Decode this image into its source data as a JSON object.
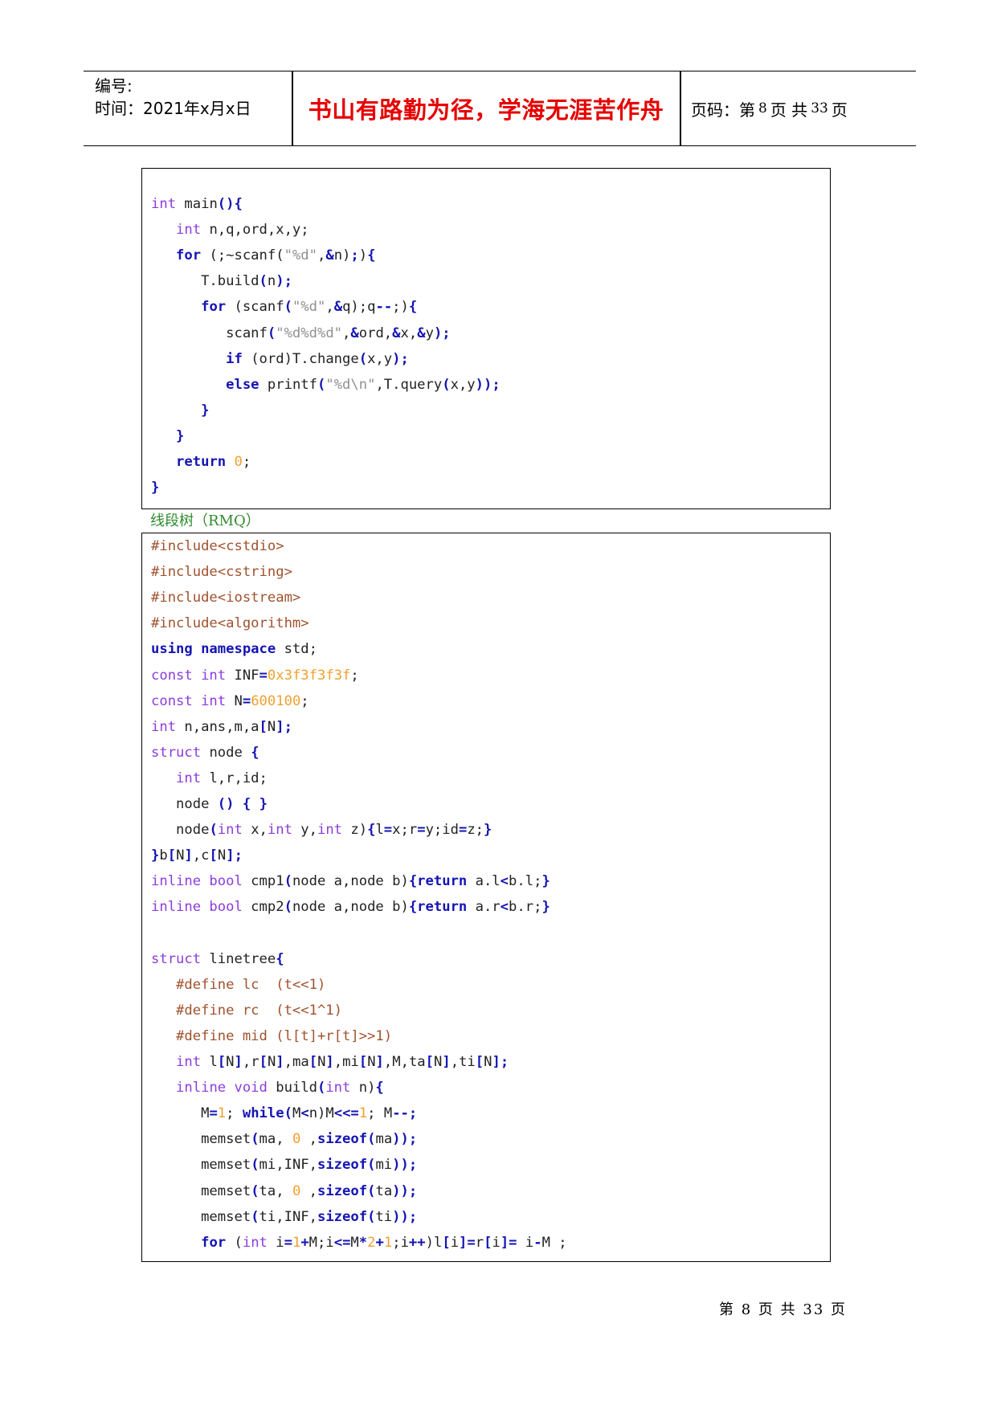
{
  "header": {
    "doc_number_label": "编号:",
    "time_label": "时间：2021年x月x日",
    "motto": "书山有路勤为径，学海无涯苦作舟",
    "page_label_prefix": "页码：第",
    "page_current": "8",
    "page_mid": "页  共",
    "page_total": "33",
    "page_suffix": "页"
  },
  "code_block_1": [
    [
      {
        "cls": "c-type",
        "t": "int"
      },
      {
        "cls": "c-def",
        "t": " main"
      },
      {
        "cls": "c-op",
        "t": "(){"
      }
    ],
    [
      {
        "cls": "c-def",
        "t": "   "
      },
      {
        "cls": "c-type",
        "t": "int"
      },
      {
        "cls": "c-def",
        "t": " n,q,ord,x,y;"
      }
    ],
    [
      {
        "cls": "c-def",
        "t": "   "
      },
      {
        "cls": "c-kw",
        "t": "for"
      },
      {
        "cls": "c-def",
        "t": " (;~scanf("
      },
      {
        "cls": "c-str",
        "t": "\"%d\""
      },
      {
        "cls": "c-def",
        "t": ","
      },
      {
        "cls": "c-op",
        "t": "&"
      },
      {
        "cls": "c-def",
        "t": "n)"
      },
      {
        "cls": "c-op",
        "t": ";"
      },
      {
        "cls": "c-def",
        "t": ")"
      },
      {
        "cls": "c-op",
        "t": "{"
      }
    ],
    [
      {
        "cls": "c-def",
        "t": "      T.build"
      },
      {
        "cls": "c-op",
        "t": "("
      },
      {
        "cls": "c-def",
        "t": "n"
      },
      {
        "cls": "c-op",
        "t": ");"
      }
    ],
    [
      {
        "cls": "c-def",
        "t": "      "
      },
      {
        "cls": "c-kw",
        "t": "for"
      },
      {
        "cls": "c-def",
        "t": " (scanf"
      },
      {
        "cls": "c-op",
        "t": "("
      },
      {
        "cls": "c-str",
        "t": "\"%d\""
      },
      {
        "cls": "c-def",
        "t": ","
      },
      {
        "cls": "c-op",
        "t": "&"
      },
      {
        "cls": "c-def",
        "t": "q);q"
      },
      {
        "cls": "c-op",
        "t": "--"
      },
      {
        "cls": "c-def",
        "t": ";)"
      },
      {
        "cls": "c-op",
        "t": "{"
      }
    ],
    [
      {
        "cls": "c-def",
        "t": "         scanf"
      },
      {
        "cls": "c-op",
        "t": "("
      },
      {
        "cls": "c-str",
        "t": "\"%d%d%d\""
      },
      {
        "cls": "c-def",
        "t": ","
      },
      {
        "cls": "c-op",
        "t": "&"
      },
      {
        "cls": "c-def",
        "t": "ord,"
      },
      {
        "cls": "c-op",
        "t": "&"
      },
      {
        "cls": "c-def",
        "t": "x,"
      },
      {
        "cls": "c-op",
        "t": "&"
      },
      {
        "cls": "c-def",
        "t": "y"
      },
      {
        "cls": "c-op",
        "t": ");"
      }
    ],
    [
      {
        "cls": "c-def",
        "t": "         "
      },
      {
        "cls": "c-kw",
        "t": "if"
      },
      {
        "cls": "c-def",
        "t": " (ord)T.change"
      },
      {
        "cls": "c-op",
        "t": "("
      },
      {
        "cls": "c-def",
        "t": "x,y"
      },
      {
        "cls": "c-op",
        "t": ");"
      }
    ],
    [
      {
        "cls": "c-def",
        "t": "         "
      },
      {
        "cls": "c-kw",
        "t": "else"
      },
      {
        "cls": "c-def",
        "t": " printf"
      },
      {
        "cls": "c-op",
        "t": "("
      },
      {
        "cls": "c-str",
        "t": "\"%d\\n\""
      },
      {
        "cls": "c-def",
        "t": ",T.query"
      },
      {
        "cls": "c-op",
        "t": "("
      },
      {
        "cls": "c-def",
        "t": "x,y"
      },
      {
        "cls": "c-op",
        "t": "));"
      }
    ],
    [
      {
        "cls": "c-def",
        "t": "      "
      },
      {
        "cls": "c-op",
        "t": "}"
      }
    ],
    [
      {
        "cls": "c-def",
        "t": "   "
      },
      {
        "cls": "c-op",
        "t": "}"
      }
    ],
    [
      {
        "cls": "c-def",
        "t": "   "
      },
      {
        "cls": "c-kw",
        "t": "return"
      },
      {
        "cls": "c-def",
        "t": " "
      },
      {
        "cls": "c-num",
        "t": "0"
      },
      {
        "cls": "c-def",
        "t": ";"
      }
    ],
    [
      {
        "cls": "c-op",
        "t": "}"
      }
    ]
  ],
  "section_title": "线段树（RMQ）",
  "code_block_2": [
    [
      {
        "cls": "c-pp",
        "t": "#include<cstdio>"
      }
    ],
    [
      {
        "cls": "c-pp",
        "t": "#include<cstring>"
      }
    ],
    [
      {
        "cls": "c-pp",
        "t": "#include<iostream>"
      }
    ],
    [
      {
        "cls": "c-pp",
        "t": "#include<algorithm>"
      }
    ],
    [
      {
        "cls": "c-kw",
        "t": "using namespace"
      },
      {
        "cls": "c-def",
        "t": " std;"
      }
    ],
    [
      {
        "cls": "c-type",
        "t": "const int"
      },
      {
        "cls": "c-def",
        "t": " INF"
      },
      {
        "cls": "c-op",
        "t": "="
      },
      {
        "cls": "c-num",
        "t": "0x3f3f3f3f"
      },
      {
        "cls": "c-def",
        "t": ";"
      }
    ],
    [
      {
        "cls": "c-type",
        "t": "const int"
      },
      {
        "cls": "c-def",
        "t": " N"
      },
      {
        "cls": "c-op",
        "t": "="
      },
      {
        "cls": "c-num",
        "t": "600100"
      },
      {
        "cls": "c-def",
        "t": ";"
      }
    ],
    [
      {
        "cls": "c-type",
        "t": "int"
      },
      {
        "cls": "c-def",
        "t": " n,ans,m,a"
      },
      {
        "cls": "c-op",
        "t": "["
      },
      {
        "cls": "c-def",
        "t": "N"
      },
      {
        "cls": "c-op",
        "t": "];"
      }
    ],
    [
      {
        "cls": "c-type",
        "t": "struct"
      },
      {
        "cls": "c-def",
        "t": " node "
      },
      {
        "cls": "c-op",
        "t": "{"
      }
    ],
    [
      {
        "cls": "c-def",
        "t": "   "
      },
      {
        "cls": "c-type",
        "t": "int"
      },
      {
        "cls": "c-def",
        "t": " l,r,id;"
      }
    ],
    [
      {
        "cls": "c-def",
        "t": "   node "
      },
      {
        "cls": "c-op",
        "t": "()"
      },
      {
        "cls": "c-def",
        "t": " "
      },
      {
        "cls": "c-op",
        "t": "{"
      },
      {
        "cls": "c-def",
        "t": " "
      },
      {
        "cls": "c-op",
        "t": "}"
      }
    ],
    [
      {
        "cls": "c-def",
        "t": "   node"
      },
      {
        "cls": "c-op",
        "t": "("
      },
      {
        "cls": "c-type",
        "t": "int"
      },
      {
        "cls": "c-def",
        "t": " x,"
      },
      {
        "cls": "c-type",
        "t": "int"
      },
      {
        "cls": "c-def",
        "t": " y,"
      },
      {
        "cls": "c-type",
        "t": "int"
      },
      {
        "cls": "c-def",
        "t": " z)"
      },
      {
        "cls": "c-op",
        "t": "{"
      },
      {
        "cls": "c-def",
        "t": "l"
      },
      {
        "cls": "c-op",
        "t": "="
      },
      {
        "cls": "c-def",
        "t": "x;r"
      },
      {
        "cls": "c-op",
        "t": "="
      },
      {
        "cls": "c-def",
        "t": "y;id"
      },
      {
        "cls": "c-op",
        "t": "="
      },
      {
        "cls": "c-def",
        "t": "z;"
      },
      {
        "cls": "c-op",
        "t": "}"
      }
    ],
    [
      {
        "cls": "c-op",
        "t": "}"
      },
      {
        "cls": "c-def",
        "t": "b"
      },
      {
        "cls": "c-op",
        "t": "["
      },
      {
        "cls": "c-def",
        "t": "N"
      },
      {
        "cls": "c-op",
        "t": "]"
      },
      {
        "cls": "c-def",
        "t": ",c"
      },
      {
        "cls": "c-op",
        "t": "["
      },
      {
        "cls": "c-def",
        "t": "N"
      },
      {
        "cls": "c-op",
        "t": "];"
      }
    ],
    [
      {
        "cls": "c-type",
        "t": "inline bool"
      },
      {
        "cls": "c-def",
        "t": " cmp1"
      },
      {
        "cls": "c-op",
        "t": "("
      },
      {
        "cls": "c-def",
        "t": "node a,node b)"
      },
      {
        "cls": "c-op",
        "t": "{"
      },
      {
        "cls": "c-kw",
        "t": "return"
      },
      {
        "cls": "c-def",
        "t": " a.l"
      },
      {
        "cls": "c-op",
        "t": "<"
      },
      {
        "cls": "c-def",
        "t": "b.l;"
      },
      {
        "cls": "c-op",
        "t": "}"
      }
    ],
    [
      {
        "cls": "c-type",
        "t": "inline bool"
      },
      {
        "cls": "c-def",
        "t": " cmp2"
      },
      {
        "cls": "c-op",
        "t": "("
      },
      {
        "cls": "c-def",
        "t": "node a,node b)"
      },
      {
        "cls": "c-op",
        "t": "{"
      },
      {
        "cls": "c-kw",
        "t": "return"
      },
      {
        "cls": "c-def",
        "t": " a.r"
      },
      {
        "cls": "c-op",
        "t": "<"
      },
      {
        "cls": "c-def",
        "t": "b.r;"
      },
      {
        "cls": "c-op",
        "t": "}"
      }
    ],
    [],
    [
      {
        "cls": "c-type",
        "t": "struct"
      },
      {
        "cls": "c-def",
        "t": " linetree"
      },
      {
        "cls": "c-op",
        "t": "{"
      }
    ],
    [
      {
        "cls": "c-def",
        "t": "   "
      },
      {
        "cls": "c-pp",
        "t": "#define lc  (t<<1)"
      }
    ],
    [
      {
        "cls": "c-def",
        "t": "   "
      },
      {
        "cls": "c-pp",
        "t": "#define rc  (t<<1^1)"
      }
    ],
    [
      {
        "cls": "c-def",
        "t": "   "
      },
      {
        "cls": "c-pp",
        "t": "#define mid (l[t]+r[t]>>1)"
      }
    ],
    [
      {
        "cls": "c-def",
        "t": "   "
      },
      {
        "cls": "c-type",
        "t": "int"
      },
      {
        "cls": "c-def",
        "t": " l"
      },
      {
        "cls": "c-op",
        "t": "["
      },
      {
        "cls": "c-def",
        "t": "N"
      },
      {
        "cls": "c-op",
        "t": "]"
      },
      {
        "cls": "c-def",
        "t": ",r"
      },
      {
        "cls": "c-op",
        "t": "["
      },
      {
        "cls": "c-def",
        "t": "N"
      },
      {
        "cls": "c-op",
        "t": "]"
      },
      {
        "cls": "c-def",
        "t": ",ma"
      },
      {
        "cls": "c-op",
        "t": "["
      },
      {
        "cls": "c-def",
        "t": "N"
      },
      {
        "cls": "c-op",
        "t": "]"
      },
      {
        "cls": "c-def",
        "t": ",mi"
      },
      {
        "cls": "c-op",
        "t": "["
      },
      {
        "cls": "c-def",
        "t": "N"
      },
      {
        "cls": "c-op",
        "t": "]"
      },
      {
        "cls": "c-def",
        "t": ",M,ta"
      },
      {
        "cls": "c-op",
        "t": "["
      },
      {
        "cls": "c-def",
        "t": "N"
      },
      {
        "cls": "c-op",
        "t": "]"
      },
      {
        "cls": "c-def",
        "t": ",ti"
      },
      {
        "cls": "c-op",
        "t": "["
      },
      {
        "cls": "c-def",
        "t": "N"
      },
      {
        "cls": "c-op",
        "t": "];"
      }
    ],
    [
      {
        "cls": "c-def",
        "t": "   "
      },
      {
        "cls": "c-type",
        "t": "inline void"
      },
      {
        "cls": "c-def",
        "t": " build"
      },
      {
        "cls": "c-op",
        "t": "("
      },
      {
        "cls": "c-type",
        "t": "int"
      },
      {
        "cls": "c-def",
        "t": " n)"
      },
      {
        "cls": "c-op",
        "t": "{"
      }
    ],
    [
      {
        "cls": "c-def",
        "t": "      M"
      },
      {
        "cls": "c-op",
        "t": "="
      },
      {
        "cls": "c-num",
        "t": "1"
      },
      {
        "cls": "c-def",
        "t": "; "
      },
      {
        "cls": "c-kw",
        "t": "while"
      },
      {
        "cls": "c-op",
        "t": "("
      },
      {
        "cls": "c-def",
        "t": "M"
      },
      {
        "cls": "c-op",
        "t": "<"
      },
      {
        "cls": "c-def",
        "t": "n)M"
      },
      {
        "cls": "c-op",
        "t": "<<="
      },
      {
        "cls": "c-num",
        "t": "1"
      },
      {
        "cls": "c-def",
        "t": "; M"
      },
      {
        "cls": "c-op",
        "t": "--;"
      }
    ],
    [
      {
        "cls": "c-def",
        "t": "      memset"
      },
      {
        "cls": "c-op",
        "t": "("
      },
      {
        "cls": "c-def",
        "t": "ma, "
      },
      {
        "cls": "c-num",
        "t": "0"
      },
      {
        "cls": "c-def",
        "t": " ,"
      },
      {
        "cls": "c-kw",
        "t": "sizeof"
      },
      {
        "cls": "c-op",
        "t": "("
      },
      {
        "cls": "c-def",
        "t": "ma"
      },
      {
        "cls": "c-op",
        "t": "));"
      }
    ],
    [
      {
        "cls": "c-def",
        "t": "      memset"
      },
      {
        "cls": "c-op",
        "t": "("
      },
      {
        "cls": "c-def",
        "t": "mi,INF,"
      },
      {
        "cls": "c-kw",
        "t": "sizeof"
      },
      {
        "cls": "c-op",
        "t": "("
      },
      {
        "cls": "c-def",
        "t": "mi"
      },
      {
        "cls": "c-op",
        "t": "));"
      }
    ],
    [
      {
        "cls": "c-def",
        "t": "      memset"
      },
      {
        "cls": "c-op",
        "t": "("
      },
      {
        "cls": "c-def",
        "t": "ta, "
      },
      {
        "cls": "c-num",
        "t": "0"
      },
      {
        "cls": "c-def",
        "t": " ,"
      },
      {
        "cls": "c-kw",
        "t": "sizeof"
      },
      {
        "cls": "c-op",
        "t": "("
      },
      {
        "cls": "c-def",
        "t": "ta"
      },
      {
        "cls": "c-op",
        "t": "));"
      }
    ],
    [
      {
        "cls": "c-def",
        "t": "      memset"
      },
      {
        "cls": "c-op",
        "t": "("
      },
      {
        "cls": "c-def",
        "t": "ti,INF,"
      },
      {
        "cls": "c-kw",
        "t": "sizeof"
      },
      {
        "cls": "c-op",
        "t": "("
      },
      {
        "cls": "c-def",
        "t": "ti"
      },
      {
        "cls": "c-op",
        "t": "));"
      }
    ],
    [
      {
        "cls": "c-def",
        "t": "      "
      },
      {
        "cls": "c-kw",
        "t": "for"
      },
      {
        "cls": "c-def",
        "t": " ("
      },
      {
        "cls": "c-type",
        "t": "int"
      },
      {
        "cls": "c-def",
        "t": " i"
      },
      {
        "cls": "c-op",
        "t": "="
      },
      {
        "cls": "c-num",
        "t": "1"
      },
      {
        "cls": "c-op",
        "t": "+"
      },
      {
        "cls": "c-def",
        "t": "M;i"
      },
      {
        "cls": "c-op",
        "t": "<="
      },
      {
        "cls": "c-def",
        "t": "M"
      },
      {
        "cls": "c-op",
        "t": "*"
      },
      {
        "cls": "c-num",
        "t": "2"
      },
      {
        "cls": "c-op",
        "t": "+"
      },
      {
        "cls": "c-num",
        "t": "1"
      },
      {
        "cls": "c-def",
        "t": ";i"
      },
      {
        "cls": "c-op",
        "t": "++"
      },
      {
        "cls": "c-def",
        "t": ")l"
      },
      {
        "cls": "c-op",
        "t": "["
      },
      {
        "cls": "c-def",
        "t": "i"
      },
      {
        "cls": "c-op",
        "t": "]="
      },
      {
        "cls": "c-def",
        "t": "r"
      },
      {
        "cls": "c-op",
        "t": "["
      },
      {
        "cls": "c-def",
        "t": "i"
      },
      {
        "cls": "c-op",
        "t": "]="
      },
      {
        "cls": "c-def",
        "t": " i"
      },
      {
        "cls": "c-op",
        "t": "-"
      },
      {
        "cls": "c-def",
        "t": "M ;"
      }
    ]
  ],
  "footer": {
    "prefix": "第",
    "page": "8",
    "mid": "页 共",
    "total": "33",
    "suffix": "页"
  }
}
